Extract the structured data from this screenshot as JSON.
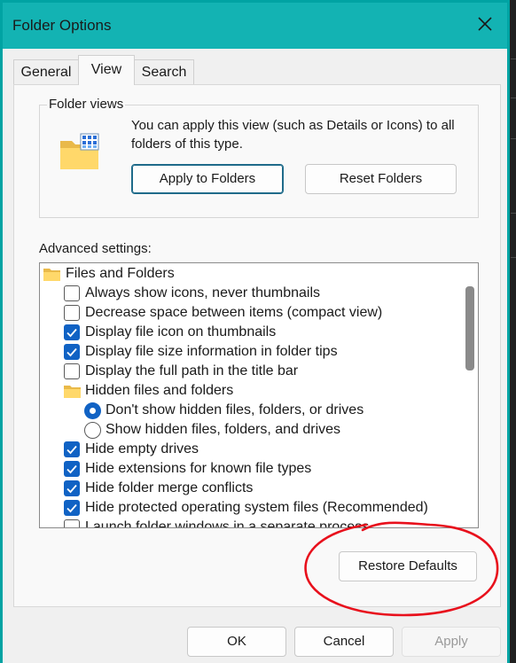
{
  "window": {
    "title": "Folder Options"
  },
  "tabs": [
    {
      "label": "General",
      "active": false
    },
    {
      "label": "View",
      "active": true
    },
    {
      "label": "Search",
      "active": false
    }
  ],
  "folder_views": {
    "label": "Folder views",
    "description": "You can apply this view (such as Details or Icons) to all folders of this type.",
    "apply_button": "Apply to Folders",
    "reset_button": "Reset Folders"
  },
  "advanced": {
    "label": "Advanced settings:",
    "items": [
      {
        "type": "folder",
        "label": "Files and Folders",
        "indent": 0
      },
      {
        "type": "checkbox",
        "label": "Always show icons, never thumbnails",
        "checked": false,
        "indent": 1
      },
      {
        "type": "checkbox",
        "label": "Decrease space between items (compact view)",
        "checked": false,
        "indent": 1
      },
      {
        "type": "checkbox",
        "label": "Display file icon on thumbnails",
        "checked": true,
        "indent": 1
      },
      {
        "type": "checkbox",
        "label": "Display file size information in folder tips",
        "checked": true,
        "indent": 1
      },
      {
        "type": "checkbox",
        "label": "Display the full path in the title bar",
        "checked": false,
        "indent": 1
      },
      {
        "type": "folder",
        "label": "Hidden files and folders",
        "indent": 1
      },
      {
        "type": "radio",
        "label": "Don't show hidden files, folders, or drives",
        "checked": true,
        "indent": 2
      },
      {
        "type": "radio",
        "label": "Show hidden files, folders, and drives",
        "checked": false,
        "indent": 2
      },
      {
        "type": "checkbox",
        "label": "Hide empty drives",
        "checked": true,
        "indent": 1
      },
      {
        "type": "checkbox",
        "label": "Hide extensions for known file types",
        "checked": true,
        "indent": 1
      },
      {
        "type": "checkbox",
        "label": "Hide folder merge conflicts",
        "checked": true,
        "indent": 1
      },
      {
        "type": "checkbox",
        "label": "Hide protected operating system files (Recommended)",
        "checked": true,
        "indent": 1
      },
      {
        "type": "checkbox",
        "label": "Launch folder windows in a separate process",
        "checked": false,
        "indent": 1
      }
    ]
  },
  "restore_defaults_button": "Restore Defaults",
  "footer": {
    "ok": "OK",
    "cancel": "Cancel",
    "apply": "Apply",
    "apply_enabled": false
  },
  "colors": {
    "title_bar": "#13b3b3",
    "checkbox_checked": "#1062c4",
    "annotation": "#e8101c"
  },
  "icons": [
    "close-icon",
    "folder-views-icon",
    "folder-icon",
    "checkmark-icon"
  ]
}
